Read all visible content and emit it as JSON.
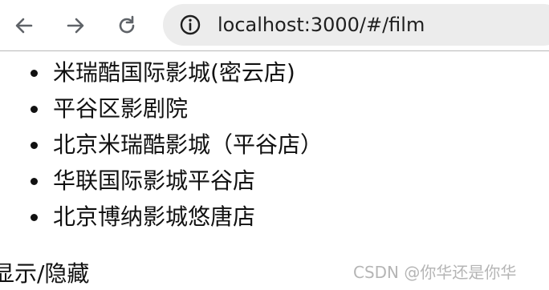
{
  "browser": {
    "url": "localhost:3000/#/film"
  },
  "cinemas": [
    {
      "name": "米瑞酷国际影城(密云店)"
    },
    {
      "name": "平谷区影剧院"
    },
    {
      "name": "北京米瑞酷影城（平谷店）"
    },
    {
      "name": "华联国际影城平谷店"
    },
    {
      "name": "北京博纳影城悠唐店"
    }
  ],
  "toggle_label": "显示/隐藏",
  "watermark": "CSDN @你华还是你华",
  "colors": {
    "icon": "#5f6368",
    "omnibox_bg": "#ececec",
    "text": "#111111"
  }
}
